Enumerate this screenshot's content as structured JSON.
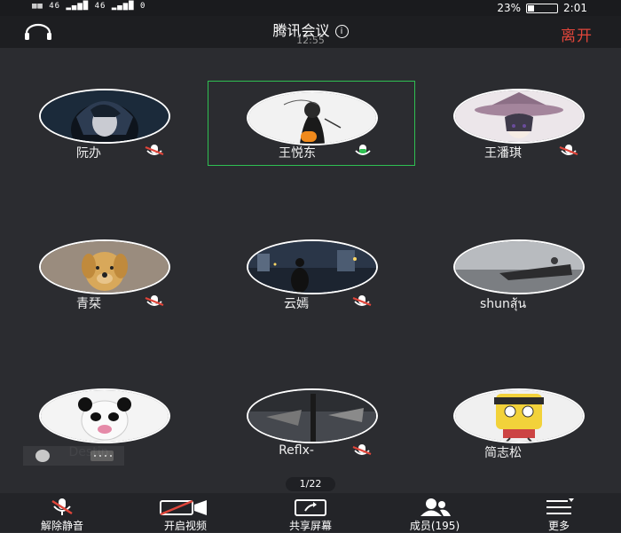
{
  "status_bar": {
    "left_text": "▦▦ 46 ▂▄▆█ 46 ▂▄▆█ 0",
    "battery": "23%",
    "clock": "2:01"
  },
  "header": {
    "title": "腾讯会议",
    "time": "12:55",
    "leave_label": "离开"
  },
  "participants": [
    {
      "name": "阮办",
      "mic": "muted",
      "active": false
    },
    {
      "name": "王悦东",
      "mic": "on",
      "active": true
    },
    {
      "name": "王潘琪",
      "mic": "muted",
      "active": false
    },
    {
      "name": "青栞",
      "mic": "muted",
      "active": false
    },
    {
      "name": "云嫣",
      "mic": "muted",
      "active": false
    },
    {
      "name": "shunสุ้น",
      "mic": "none",
      "active": false
    },
    {
      "name": "Destin",
      "mic": "none",
      "active": false
    },
    {
      "name": "Reflx-",
      "mic": "muted",
      "active": false
    },
    {
      "name": "简志松",
      "mic": "none",
      "active": false
    }
  ],
  "page_indicator": "1/22",
  "toolbar": {
    "unmute": "解除静音",
    "video": "开启视频",
    "share": "共享屏幕",
    "members": "成员(195)",
    "more": "更多"
  },
  "colors": {
    "accent_green": "#2fbf52",
    "leave_red": "#e0453a",
    "host_orange": "#f08a1c"
  },
  "battery_level": 0.23
}
